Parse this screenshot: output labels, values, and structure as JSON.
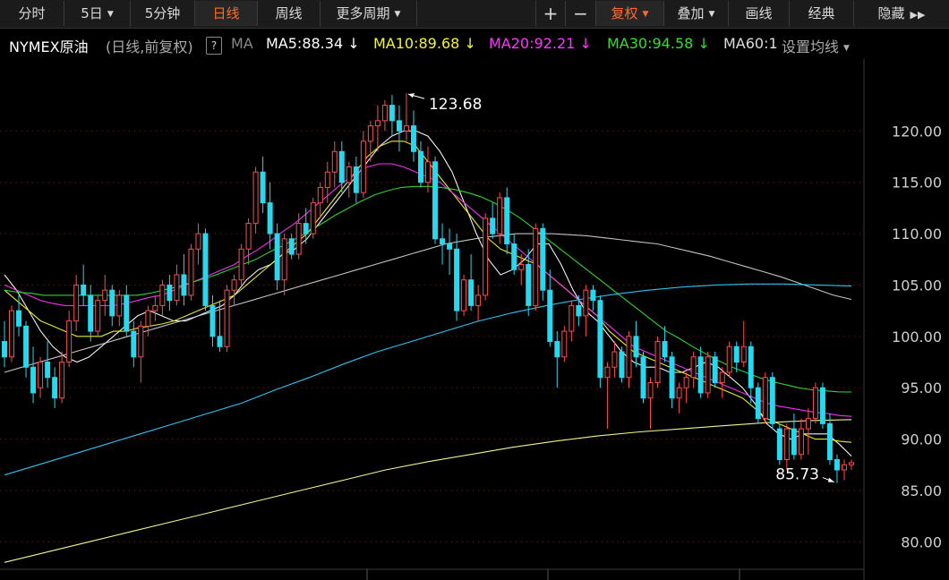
{
  "toolbar": {
    "tabs": [
      {
        "label": "分时"
      },
      {
        "label": "5日"
      },
      {
        "label": "5分钟"
      },
      {
        "label": "日线"
      },
      {
        "label": "周线"
      },
      {
        "label": "更多周期"
      }
    ],
    "plus": "+",
    "minus": "−",
    "fuquan": "复权",
    "diejia": "叠加",
    "huaxian": "画线",
    "jingdian": "经典",
    "yincang": "隐藏"
  },
  "legend": {
    "name": "NYMEX原油",
    "mode": "(日线,前复权)",
    "help": "?",
    "ma_label": "MA",
    "ma5": "MA5:88.34",
    "ma10": "MA10:89.68",
    "ma20": "MA20:92.21",
    "ma30": "MA30:94.58",
    "ma60": "MA60:1",
    "settings": "设置均线",
    "arrow": "↓"
  },
  "colors": {
    "up": "#ff4d4d",
    "down": "#26d9ee",
    "ma5": "#ffffff",
    "ma10": "#f5f52a",
    "ma20": "#ff33ff",
    "ma30": "#33dd33",
    "ma60": "#cccccc",
    "ma_long1": "#33ccff",
    "ma_long2": "#ffff99",
    "active": "#ff6a2b"
  },
  "chart_data": {
    "type": "candlestick",
    "y_ticks": [
      "120.00",
      "115.00",
      "110.00",
      "105.00",
      "100.00",
      "95.00",
      "90.00",
      "85.00",
      "80.00"
    ],
    "ylim": [
      77.5,
      127.0
    ],
    "grid": true,
    "high_label": "123.68",
    "low_label": "85.73",
    "series": [
      {
        "name": "MA5",
        "values": [
          106.0,
          104.5,
          102.5,
          100.5,
          99.0,
          98.0,
          97.5,
          98.0,
          99.0,
          100.0,
          101.0,
          102.0,
          102.5,
          102.0,
          101.5,
          101.5,
          102.0,
          102.5,
          103.0,
          104.0,
          105.5,
          106.5,
          107.0,
          108.0,
          108.5,
          109.5,
          111.0,
          112.5,
          114.0,
          115.5,
          117.0,
          118.5,
          119.5,
          120.0,
          120.0,
          119.5,
          118.0,
          116.0,
          113.0,
          110.0,
          107.5,
          106.0,
          106.5,
          107.5,
          109.0,
          109.0,
          107.0,
          104.5,
          102.5,
          101.5,
          100.0,
          98.5,
          97.5,
          97.0,
          97.0,
          96.5,
          96.5,
          97.0,
          97.5,
          97.0,
          96.0,
          95.0,
          93.5,
          91.5,
          90.5,
          90.0,
          90.5,
          90.5,
          90.5,
          89.5,
          88.34
        ]
      },
      {
        "name": "MA10",
        "values": [
          104.5,
          103.5,
          102.5,
          101.5,
          101.0,
          100.5,
          100.0,
          100.0,
          100.0,
          100.5,
          100.5,
          100.8,
          101.0,
          101.2,
          101.5,
          102.0,
          102.5,
          103.0,
          103.5,
          104.0,
          105.0,
          106.0,
          107.0,
          108.0,
          109.0,
          110.0,
          111.5,
          113.0,
          114.5,
          116.0,
          117.5,
          118.5,
          119.0,
          119.0,
          118.5,
          117.0,
          115.5,
          114.0,
          112.5,
          111.0,
          109.5,
          108.5,
          108.0,
          107.5,
          107.0,
          106.0,
          105.0,
          104.0,
          103.0,
          102.0,
          100.5,
          99.5,
          98.5,
          98.0,
          97.5,
          97.0,
          96.5,
          96.0,
          95.5,
          95.0,
          94.5,
          94.0,
          93.0,
          92.0,
          91.5,
          91.0,
          90.5,
          90.0,
          90.0,
          89.8,
          89.68
        ]
      },
      {
        "name": "MA20",
        "values": [
          105.0,
          104.5,
          104.0,
          103.5,
          103.2,
          103.0,
          103.0,
          103.0,
          103.0,
          103.0,
          103.2,
          103.5,
          103.8,
          104.0,
          104.5,
          105.0,
          105.5,
          106.0,
          106.5,
          107.0,
          107.8,
          108.5,
          109.3,
          110.2,
          111.0,
          112.0,
          113.0,
          114.0,
          115.0,
          115.8,
          116.5,
          116.8,
          116.8,
          116.5,
          116.0,
          115.5,
          115.0,
          114.0,
          113.0,
          112.0,
          111.0,
          110.0,
          109.0,
          108.0,
          107.0,
          106.0,
          105.0,
          104.0,
          103.0,
          102.0,
          101.0,
          100.0,
          99.0,
          98.5,
          98.0,
          97.5,
          97.0,
          96.5,
          96.0,
          95.5,
          95.0,
          94.5,
          94.0,
          93.5,
          93.2,
          93.0,
          92.8,
          92.6,
          92.5,
          92.3,
          92.21
        ]
      },
      {
        "name": "MA30",
        "values": [
          104.5,
          104.3,
          104.2,
          104.0,
          104.0,
          104.0,
          104.0,
          104.0,
          104.0,
          104.0,
          104.0,
          104.2,
          104.5,
          104.8,
          105.2,
          105.6,
          106.0,
          106.5,
          107.0,
          107.5,
          108.2,
          108.8,
          109.5,
          110.2,
          111.0,
          111.8,
          112.5,
          113.2,
          113.8,
          114.2,
          114.5,
          114.6,
          114.6,
          114.5,
          114.3,
          114.0,
          113.6,
          113.0,
          112.3,
          111.5,
          110.5,
          109.5,
          108.5,
          107.5,
          106.5,
          105.5,
          104.5,
          103.5,
          102.5,
          101.5,
          100.5,
          99.8,
          99.0,
          98.3,
          97.6,
          97.0,
          96.5,
          96.0,
          95.6,
          95.3,
          95.0,
          94.8,
          94.7,
          94.6,
          94.58
        ]
      },
      {
        "name": "MA60",
        "values": [
          96.5,
          97.0,
          97.5,
          98.0,
          98.5,
          99.0,
          99.5,
          100.0,
          100.5,
          101.0,
          101.5,
          102.0,
          102.5,
          103.0,
          103.5,
          104.0,
          104.5,
          105.0,
          105.5,
          106.0,
          106.5,
          107.0,
          107.5,
          108.0,
          108.5,
          109.0,
          109.3,
          109.6,
          109.8,
          110.0,
          110.0,
          110.0,
          109.9,
          109.8,
          109.6,
          109.4,
          109.2,
          109.0,
          108.6,
          108.2,
          107.8,
          107.3,
          106.8,
          106.3,
          105.8,
          105.2,
          104.6,
          104.0,
          103.6
        ]
      },
      {
        "name": "MA120",
        "values": [
          86.5,
          87.5,
          88.5,
          89.5,
          90.5,
          91.5,
          92.5,
          93.5,
          94.8,
          96.0,
          97.3,
          98.5,
          99.5,
          100.5,
          101.5,
          102.3,
          103.0,
          103.6,
          104.1,
          104.5,
          104.8,
          105.0,
          105.1,
          105.1,
          105.0,
          104.9
        ]
      },
      {
        "name": "MA250",
        "values": [
          78.0,
          79.0,
          80.0,
          81.0,
          82.0,
          83.0,
          84.0,
          85.0,
          86.0,
          87.0,
          87.8,
          88.5,
          89.2,
          89.8,
          90.3,
          90.7,
          91.0,
          91.3,
          91.6,
          91.8,
          91.9
        ]
      }
    ],
    "candles": [
      [
        99.5,
        101.5,
        97.0,
        98.0
      ],
      [
        98.0,
        103.0,
        97.5,
        102.5
      ],
      [
        102.5,
        104.0,
        100.0,
        101.0
      ],
      [
        101.0,
        101.5,
        96.0,
        97.0
      ],
      [
        97.0,
        99.0,
        93.5,
        94.5
      ],
      [
        95.0,
        98.0,
        94.0,
        97.5
      ],
      [
        97.5,
        99.5,
        95.0,
        96.0
      ],
      [
        96.0,
        97.0,
        93.0,
        94.0
      ],
      [
        94.0,
        98.5,
        93.5,
        97.5
      ],
      [
        97.5,
        102.5,
        97.0,
        101.5
      ],
      [
        101.5,
        106.0,
        100.5,
        105.0
      ],
      [
        105.0,
        107.0,
        103.0,
        104.0
      ],
      [
        104.0,
        105.0,
        99.5,
        100.5
      ],
      [
        100.5,
        104.0,
        100.0,
        103.5
      ],
      [
        103.5,
        106.0,
        102.0,
        104.5
      ],
      [
        104.5,
        105.0,
        101.0,
        102.0
      ],
      [
        102.0,
        104.5,
        101.0,
        104.0
      ],
      [
        104.0,
        105.0,
        100.0,
        100.5
      ],
      [
        100.5,
        101.5,
        97.0,
        98.0
      ],
      [
        98.0,
        101.5,
        95.5,
        101.0
      ],
      [
        101.0,
        103.0,
        100.0,
        102.5
      ],
      [
        102.5,
        104.0,
        101.5,
        103.0
      ],
      [
        103.0,
        105.5,
        102.0,
        105.0
      ],
      [
        105.0,
        106.0,
        102.5,
        103.5
      ],
      [
        103.5,
        107.0,
        103.0,
        106.0
      ],
      [
        106.0,
        108.0,
        103.0,
        104.0
      ],
      [
        104.0,
        109.0,
        103.5,
        108.5
      ],
      [
        108.5,
        111.0,
        107.0,
        110.0
      ],
      [
        110.0,
        110.5,
        102.5,
        103.0
      ],
      [
        103.0,
        104.0,
        99.0,
        100.0
      ],
      [
        100.0,
        103.5,
        98.5,
        99.0
      ],
      [
        99.0,
        105.0,
        98.5,
        104.5
      ],
      [
        104.5,
        106.0,
        103.0,
        105.5
      ],
      [
        105.5,
        109.0,
        105.0,
        108.5
      ],
      [
        108.5,
        111.5,
        107.0,
        111.0
      ],
      [
        111.0,
        116.5,
        110.0,
        116.0
      ],
      [
        116.0,
        117.5,
        112.0,
        113.0
      ],
      [
        113.0,
        115.0,
        108.5,
        110.0
      ],
      [
        110.0,
        111.0,
        104.5,
        105.5
      ],
      [
        105.5,
        110.0,
        104.0,
        109.5
      ],
      [
        109.5,
        110.0,
        107.5,
        108.0
      ],
      [
        108.0,
        112.0,
        107.5,
        111.0
      ],
      [
        111.0,
        112.5,
        109.0,
        110.0
      ],
      [
        110.0,
        113.5,
        109.5,
        113.0
      ],
      [
        113.0,
        115.0,
        111.5,
        114.5
      ],
      [
        114.5,
        117.0,
        113.0,
        116.0
      ],
      [
        116.0,
        119.0,
        114.5,
        118.0
      ],
      [
        118.0,
        119.0,
        114.0,
        115.0
      ],
      [
        115.0,
        117.0,
        113.5,
        116.5
      ],
      [
        116.5,
        117.5,
        113.0,
        114.0
      ],
      [
        114.0,
        120.0,
        113.5,
        119.0
      ],
      [
        119.0,
        121.0,
        117.0,
        120.5
      ],
      [
        120.5,
        122.5,
        118.0,
        121.0
      ],
      [
        121.0,
        123.0,
        120.0,
        122.5
      ],
      [
        122.5,
        123.5,
        119.5,
        121.0
      ],
      [
        121.0,
        122.5,
        118.0,
        120.0
      ],
      [
        120.0,
        123.68,
        119.0,
        120.5
      ],
      [
        120.5,
        122.0,
        117.0,
        118.0
      ],
      [
        118.0,
        119.0,
        114.5,
        115.0
      ],
      [
        115.0,
        118.5,
        114.0,
        117.0
      ],
      [
        117.0,
        117.5,
        109.0,
        109.5
      ],
      [
        109.5,
        111.0,
        107.0,
        109.0
      ],
      [
        109.0,
        110.5,
        106.0,
        108.5
      ],
      [
        108.5,
        110.0,
        101.5,
        102.5
      ],
      [
        102.5,
        106.0,
        102.0,
        105.5
      ],
      [
        105.5,
        108.0,
        102.5,
        103.0
      ],
      [
        103.0,
        105.0,
        101.5,
        104.0
      ],
      [
        104.0,
        112.0,
        103.5,
        111.5
      ],
      [
        111.5,
        113.0,
        109.5,
        110.0
      ],
      [
        110.0,
        114.0,
        109.0,
        113.5
      ],
      [
        113.5,
        114.5,
        108.0,
        109.0
      ],
      [
        109.0,
        110.0,
        106.0,
        106.5
      ],
      [
        106.5,
        108.0,
        105.0,
        107.0
      ],
      [
        107.0,
        108.5,
        102.0,
        103.0
      ],
      [
        103.0,
        111.0,
        102.5,
        110.5
      ],
      [
        110.5,
        111.0,
        103.5,
        104.5
      ],
      [
        104.5,
        106.5,
        99.0,
        99.5
      ],
      [
        99.5,
        100.5,
        95.0,
        98.0
      ],
      [
        98.0,
        101.0,
        97.5,
        100.5
      ],
      [
        100.5,
        103.5,
        99.5,
        103.0
      ],
      [
        103.0,
        104.0,
        101.0,
        102.0
      ],
      [
        102.0,
        105.0,
        100.0,
        104.5
      ],
      [
        104.5,
        105.0,
        102.5,
        103.5
      ],
      [
        103.5,
        104.0,
        95.0,
        96.0
      ],
      [
        96.0,
        97.5,
        91.0,
        97.0
      ],
      [
        97.0,
        99.5,
        96.0,
        98.5
      ],
      [
        98.5,
        99.0,
        95.5,
        96.0
      ],
      [
        96.0,
        100.5,
        95.0,
        100.0
      ],
      [
        100.0,
        101.5,
        97.0,
        98.0
      ],
      [
        98.0,
        98.5,
        93.5,
        94.0
      ],
      [
        94.0,
        96.0,
        91.0,
        95.5
      ],
      [
        95.5,
        100.0,
        95.0,
        99.5
      ],
      [
        99.5,
        101.0,
        97.5,
        98.0
      ],
      [
        98.0,
        98.5,
        93.0,
        94.0
      ],
      [
        94.0,
        95.5,
        92.5,
        95.0
      ],
      [
        95.0,
        96.5,
        93.5,
        96.0
      ],
      [
        96.0,
        98.5,
        95.0,
        98.0
      ],
      [
        98.0,
        99.0,
        94.0,
        94.5
      ],
      [
        94.5,
        98.5,
        94.0,
        98.0
      ],
      [
        98.0,
        98.5,
        95.0,
        95.5
      ],
      [
        95.5,
        97.0,
        94.0,
        96.5
      ],
      [
        96.5,
        99.5,
        96.0,
        99.0
      ],
      [
        99.0,
        99.5,
        96.5,
        97.5
      ],
      [
        97.5,
        101.5,
        97.0,
        99.0
      ],
      [
        99.0,
        99.5,
        93.5,
        95.0
      ],
      [
        95.0,
        95.5,
        91.5,
        92.0
      ],
      [
        92.0,
        96.5,
        91.5,
        96.0
      ],
      [
        96.0,
        96.5,
        91.0,
        91.5
      ],
      [
        91.0,
        91.5,
        87.5,
        88.0
      ],
      [
        88.0,
        91.5,
        87.0,
        91.0
      ],
      [
        91.0,
        92.5,
        88.0,
        88.5
      ],
      [
        88.5,
        92.0,
        88.0,
        91.0
      ],
      [
        91.0,
        93.0,
        88.5,
        92.0
      ],
      [
        92.0,
        95.5,
        91.5,
        95.0
      ],
      [
        95.0,
        95.5,
        91.0,
        91.5
      ],
      [
        91.5,
        92.5,
        87.5,
        88.0
      ],
      [
        88.0,
        88.5,
        85.73,
        87.0
      ],
      [
        87.0,
        88.0,
        86.0,
        87.5
      ],
      [
        87.5,
        88.0,
        87.0,
        87.7
      ]
    ]
  }
}
